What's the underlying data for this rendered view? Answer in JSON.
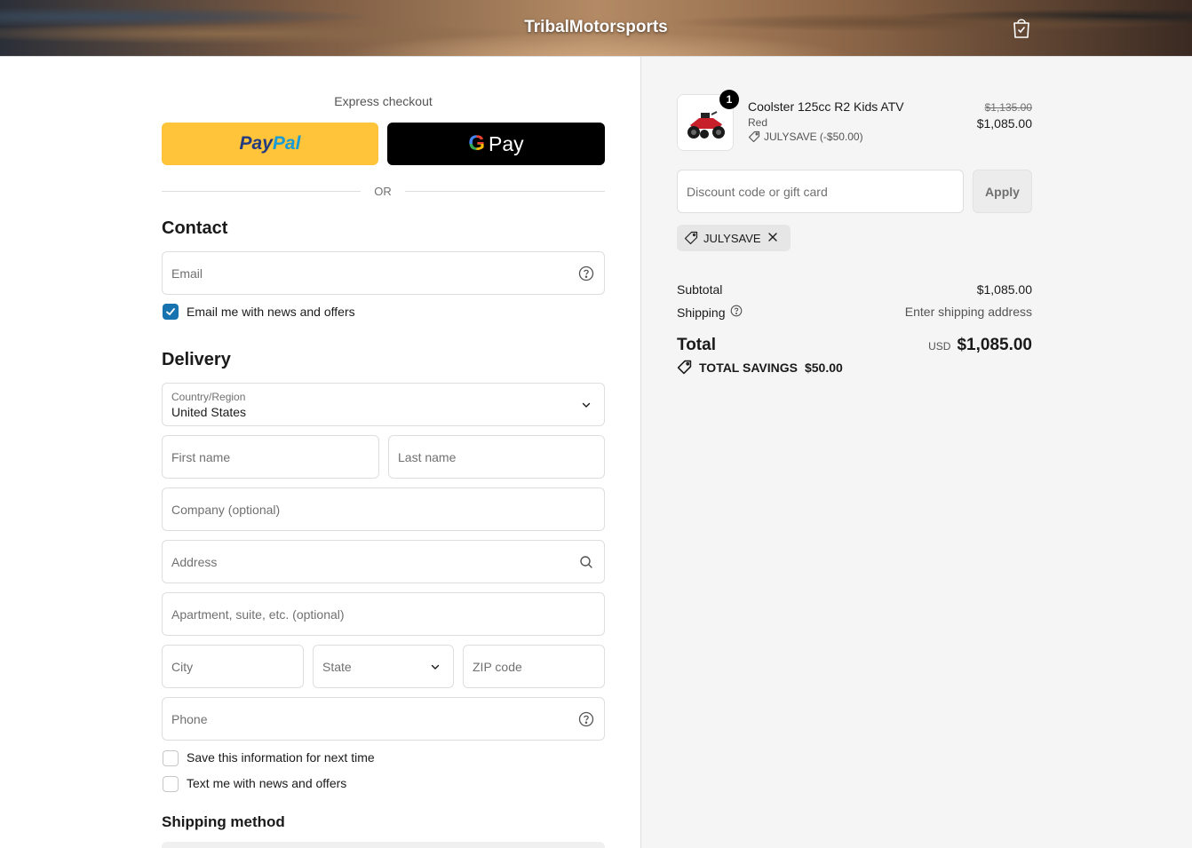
{
  "header": {
    "brand": "TribalMotorsports"
  },
  "express": {
    "label": "Express checkout",
    "paypal_a": "Pay",
    "paypal_b": "Pal",
    "gpay_g": "G",
    "gpay_text": "Pay",
    "or": "OR"
  },
  "contact": {
    "title": "Contact",
    "email_placeholder": "Email",
    "news_label": "Email me with news and offers",
    "news_checked": true
  },
  "delivery": {
    "title": "Delivery",
    "country_label": "Country/Region",
    "country_value": "United States",
    "first_name": "First name",
    "last_name": "Last name",
    "company": "Company (optional)",
    "address": "Address",
    "apartment": "Apartment, suite, etc. (optional)",
    "city": "City",
    "state": "State",
    "zip": "ZIP code",
    "phone": "Phone",
    "save_info": "Save this information for next time",
    "text_offers": "Text me with news and offers"
  },
  "shipping_method": {
    "title": "Shipping method"
  },
  "summary": {
    "item": {
      "quantity": "1",
      "name": "Coolster 125cc R2 Kids ATV",
      "variant": "Red",
      "discount": "JULYSAVE (-$50.00)",
      "price_original": "$1,135.00",
      "price": "$1,085.00"
    },
    "discount_placeholder": "Discount code or gift card",
    "apply": "Apply",
    "applied_code": "JULYSAVE",
    "subtotal_label": "Subtotal",
    "subtotal_value": "$1,085.00",
    "shipping_label": "Shipping",
    "shipping_value": "Enter shipping address",
    "total_label": "Total",
    "currency": "USD",
    "total_value": "$1,085.00",
    "savings_label": "TOTAL SAVINGS",
    "savings_value": "$50.00"
  },
  "colors": {
    "accent": "#1773b0",
    "paypal": "#ffc439",
    "gpay": "#000000"
  }
}
